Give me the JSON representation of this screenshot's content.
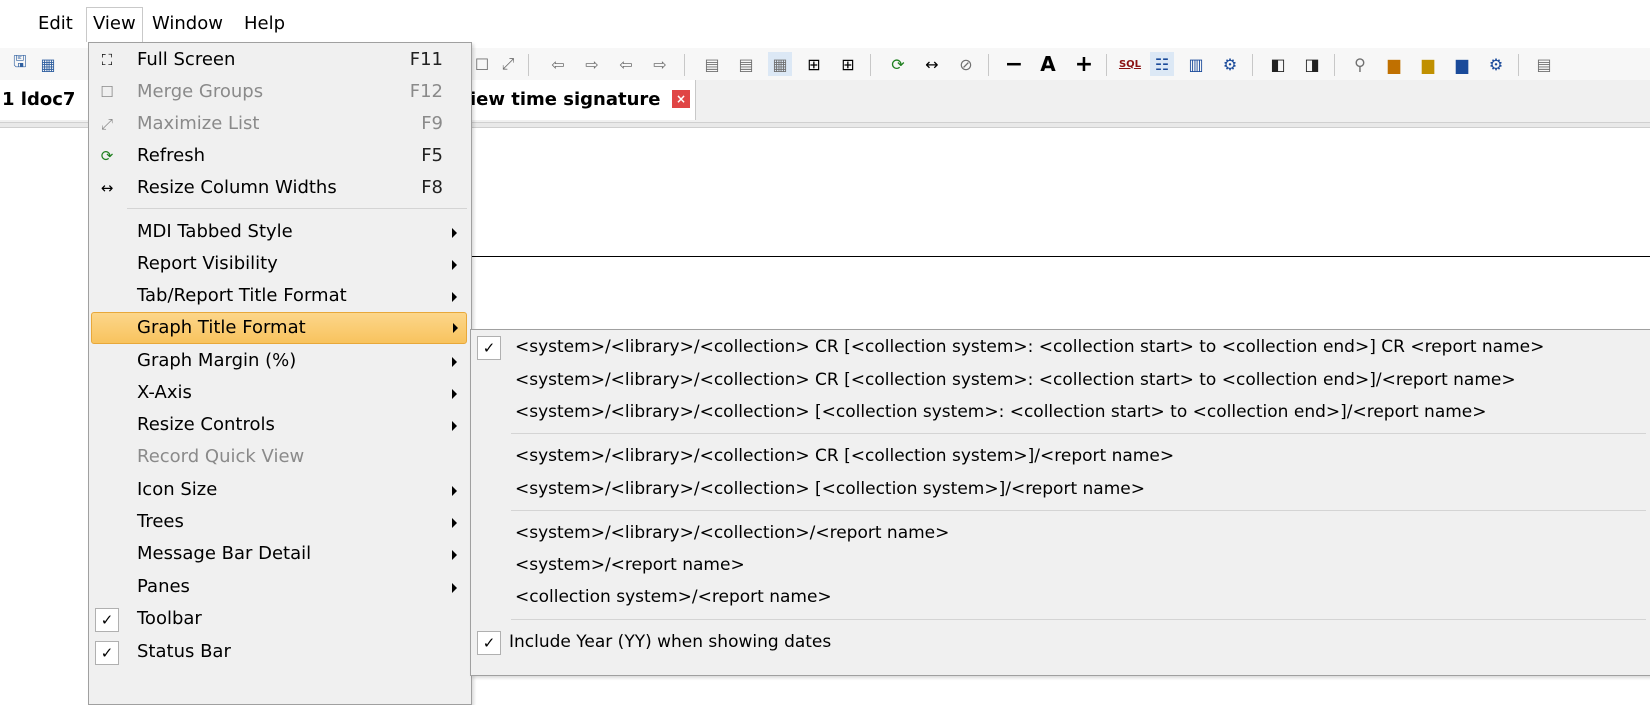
{
  "menubar": {
    "edit": "Edit",
    "view": "View",
    "window": "Window",
    "help": "Help"
  },
  "tabs": {
    "left": "1 ldoc7",
    "active": "iew time signature",
    "close": "×"
  },
  "view_menu": {
    "items": [
      {
        "label": "Full Screen",
        "shortcut": "F11"
      },
      {
        "label": "Merge Groups",
        "shortcut": "F12"
      },
      {
        "label": "Maximize List",
        "shortcut": "F9"
      },
      {
        "label": "Refresh",
        "shortcut": "F5"
      },
      {
        "label": "Resize Column Widths",
        "shortcut": "F8"
      },
      {
        "label": "MDI Tabbed Style"
      },
      {
        "label": "Report Visibility"
      },
      {
        "label": "Tab/Report Title Format"
      },
      {
        "label": "Graph Title Format"
      },
      {
        "label": "Graph Margin (%)"
      },
      {
        "label": "X-Axis"
      },
      {
        "label": "Resize Controls"
      },
      {
        "label": "Record Quick View"
      },
      {
        "label": "Icon Size"
      },
      {
        "label": "Trees"
      },
      {
        "label": "Message Bar Detail"
      },
      {
        "label": "Panes"
      },
      {
        "label": "Toolbar",
        "checked": true
      },
      {
        "label": "Status Bar",
        "checked": true
      }
    ]
  },
  "graph_title_submenu": {
    "items": [
      {
        "label": "<system>/<library>/<collection> CR [<collection system>: <collection start> to <collection end>] CR <report name>",
        "checked": true
      },
      {
        "label": "<system>/<library>/<collection> CR [<collection system>: <collection start> to <collection end>]/<report name>"
      },
      {
        "label": "<system>/<library>/<collection> [<collection system>: <collection start> to <collection end>]/<report name>"
      },
      {
        "label": "<system>/<library>/<collection> CR [<collection system>]/<report name>"
      },
      {
        "label": "<system>/<library>/<collection> [<collection system>]/<report name>"
      },
      {
        "label": "<system>/<library>/<collection>/<report name>"
      },
      {
        "label": "<system>/<report name>"
      },
      {
        "label": "<collection system>/<report name>"
      },
      {
        "label": "Include Year (YY) when showing dates",
        "checked": true
      }
    ]
  },
  "colors": {
    "highlight": "#f8c35e",
    "menu_bg": "#f0f0f0",
    "close_red": "#e04545"
  },
  "icons": [
    "save-icon",
    "report-icon",
    "full-screen-icon",
    "refresh-icon",
    "resize-columns-icon",
    "font-icon",
    "sql-icon",
    "zoom-icon"
  ]
}
